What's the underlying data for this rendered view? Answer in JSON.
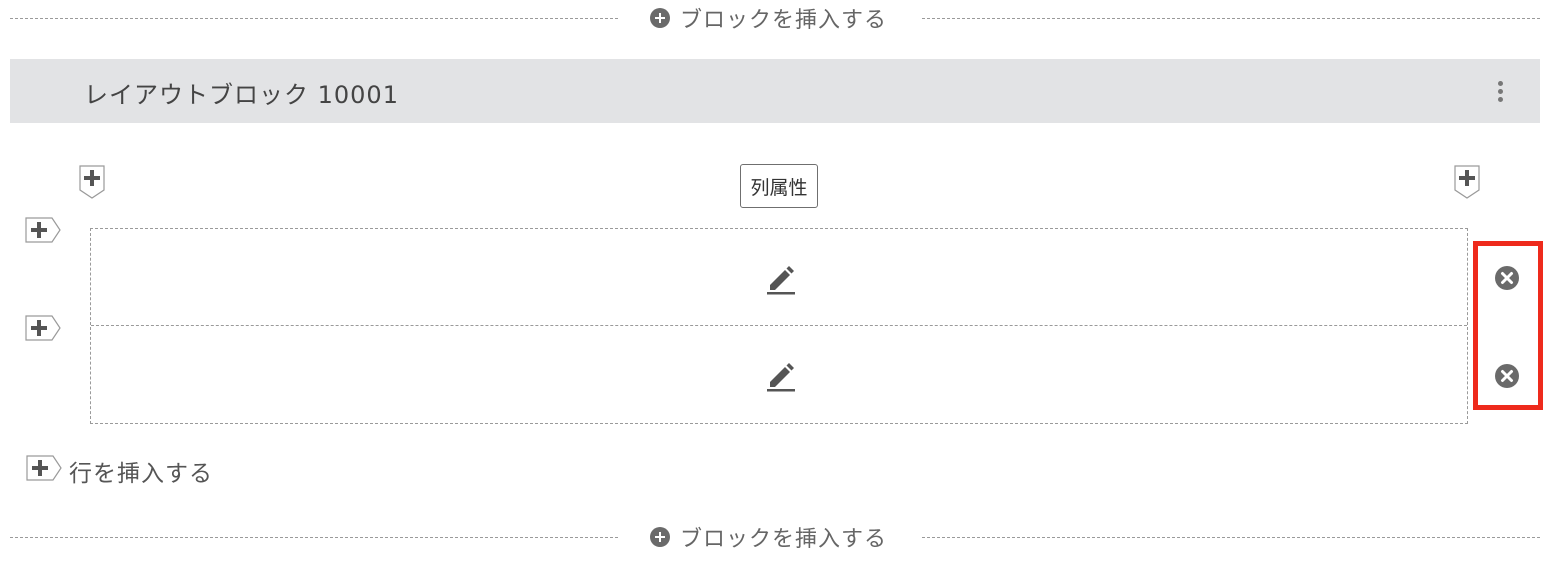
{
  "insert_block_top": {
    "label": "ブロックを挿入する",
    "icon": "plus-circle-icon"
  },
  "layout_block": {
    "title": "レイアウトブロック 10001",
    "menu_icon": "kebab-menu-icon"
  },
  "column_attribute_label": "列属性",
  "rows": [
    {
      "edit_icon": "pencil-icon",
      "remove_icon": "close-circle-icon"
    },
    {
      "edit_icon": "pencil-icon",
      "remove_icon": "close-circle-icon"
    }
  ],
  "insert_row": {
    "label": "行を挿入する",
    "icon": "plus-tag-icon"
  },
  "insert_block_bottom": {
    "label": "ブロックを挿入する",
    "icon": "plus-circle-icon"
  },
  "colors": {
    "header_bg": "#e2e3e5",
    "highlight": "#ee2a1c",
    "icon_gray": "#6a6a6a"
  }
}
